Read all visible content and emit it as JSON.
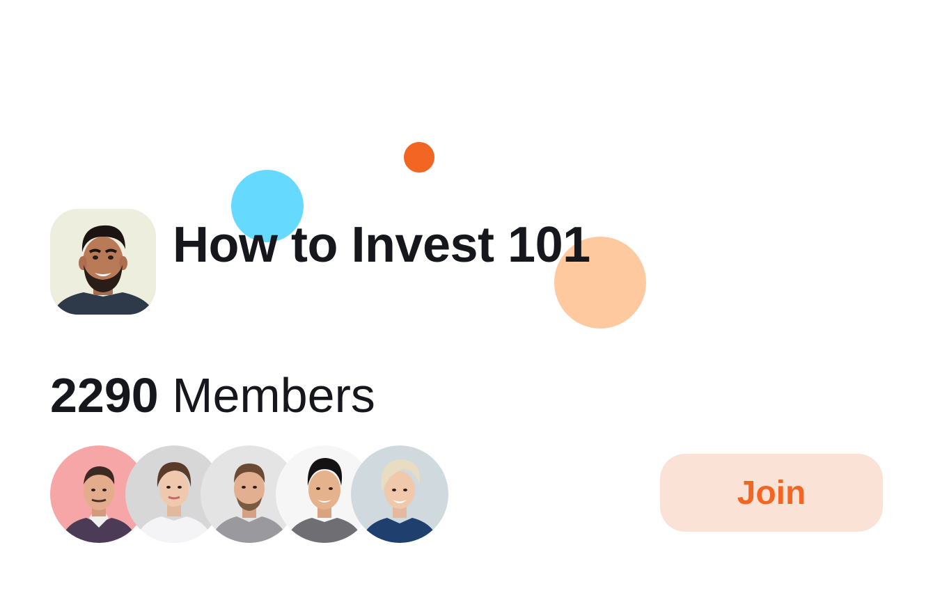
{
  "colors": {
    "text": "#16161d",
    "accent": "#f26522",
    "accent_soft": "#fbe2d7",
    "bubble_blue": "#66d9ff",
    "bubble_orange": "#f26522",
    "bubble_peach": "#ffc9a0"
  },
  "group": {
    "title": "How to Invest 101",
    "avatar_icon": "profile-photo-bearded-man"
  },
  "members": {
    "count": "2290",
    "label": "Members",
    "avatars": [
      {
        "icon": "member-photo-1"
      },
      {
        "icon": "member-photo-2"
      },
      {
        "icon": "member-photo-3"
      },
      {
        "icon": "member-photo-4"
      },
      {
        "icon": "member-photo-5"
      }
    ]
  },
  "join": {
    "label": "Join"
  }
}
